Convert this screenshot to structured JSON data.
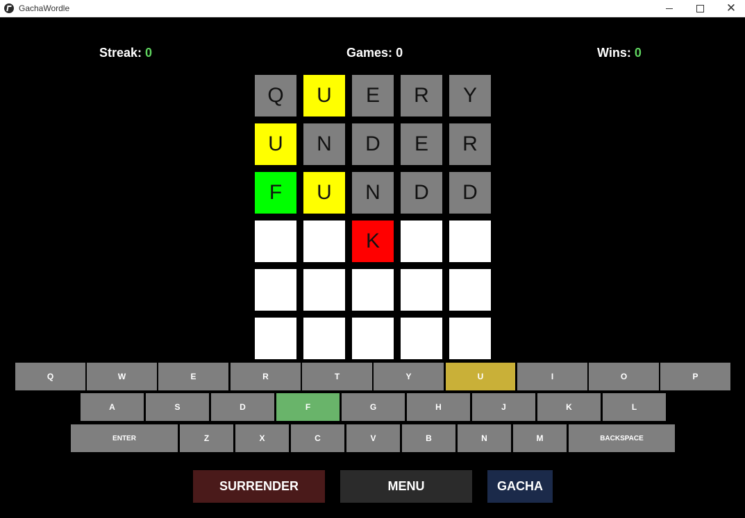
{
  "window": {
    "title": "GachaWordle",
    "minimize_icon": "minimize-icon",
    "maximize_icon": "maximize-icon",
    "close_icon": "close-icon",
    "close_glyph": "✕"
  },
  "stats": {
    "streak_label": "Streak:",
    "streak_value": "0",
    "games_label": "Games:",
    "games_value": "0",
    "wins_label": "Wins:",
    "wins_value": "0"
  },
  "colors": {
    "tile_gray": "#7f7f7f",
    "tile_yellow": "#ffff00",
    "tile_green": "#00ff00",
    "tile_red": "#ff0000",
    "tile_empty": "#ffffff",
    "key_default": "#7f7f7f",
    "key_present": "#c9b038",
    "key_correct": "#69b46a",
    "surrender_bg": "#4a1a1a",
    "menu_bg": "#2b2b2b",
    "gacha_bg": "#1b2a4a",
    "stat_value": "#5fd35f"
  },
  "board": [
    [
      {
        "letter": "Q",
        "state": "gray"
      },
      {
        "letter": "U",
        "state": "yellow"
      },
      {
        "letter": "E",
        "state": "gray"
      },
      {
        "letter": "R",
        "state": "gray"
      },
      {
        "letter": "Y",
        "state": "gray"
      }
    ],
    [
      {
        "letter": "U",
        "state": "yellow"
      },
      {
        "letter": "N",
        "state": "gray"
      },
      {
        "letter": "D",
        "state": "gray"
      },
      {
        "letter": "E",
        "state": "gray"
      },
      {
        "letter": "R",
        "state": "gray"
      }
    ],
    [
      {
        "letter": "F",
        "state": "green"
      },
      {
        "letter": "U",
        "state": "yellow"
      },
      {
        "letter": "N",
        "state": "gray"
      },
      {
        "letter": "D",
        "state": "gray"
      },
      {
        "letter": "D",
        "state": "gray"
      }
    ],
    [
      {
        "letter": "",
        "state": "empty"
      },
      {
        "letter": "",
        "state": "empty"
      },
      {
        "letter": "K",
        "state": "red"
      },
      {
        "letter": "",
        "state": "empty"
      },
      {
        "letter": "",
        "state": "empty"
      }
    ],
    [
      {
        "letter": "",
        "state": "empty"
      },
      {
        "letter": "",
        "state": "empty"
      },
      {
        "letter": "",
        "state": "empty"
      },
      {
        "letter": "",
        "state": "empty"
      },
      {
        "letter": "",
        "state": "empty"
      }
    ],
    [
      {
        "letter": "",
        "state": "empty"
      },
      {
        "letter": "",
        "state": "empty"
      },
      {
        "letter": "",
        "state": "empty"
      },
      {
        "letter": "",
        "state": "empty"
      },
      {
        "letter": "",
        "state": "empty"
      }
    ]
  ],
  "keyboard": {
    "rows": [
      [
        {
          "label": "Q",
          "state": "default"
        },
        {
          "label": "W",
          "state": "default"
        },
        {
          "label": "E",
          "state": "default"
        },
        {
          "label": "R",
          "state": "default"
        },
        {
          "label": "T",
          "state": "default"
        },
        {
          "label": "Y",
          "state": "default"
        },
        {
          "label": "U",
          "state": "present"
        },
        {
          "label": "I",
          "state": "default"
        },
        {
          "label": "O",
          "state": "default"
        },
        {
          "label": "P",
          "state": "default"
        }
      ],
      [
        {
          "label": "A",
          "state": "default"
        },
        {
          "label": "S",
          "state": "default"
        },
        {
          "label": "D",
          "state": "default"
        },
        {
          "label": "F",
          "state": "correct"
        },
        {
          "label": "G",
          "state": "default"
        },
        {
          "label": "H",
          "state": "default"
        },
        {
          "label": "J",
          "state": "default"
        },
        {
          "label": "K",
          "state": "default"
        },
        {
          "label": "L",
          "state": "default"
        }
      ],
      [
        {
          "label": "ENTER",
          "state": "default"
        },
        {
          "label": "Z",
          "state": "default"
        },
        {
          "label": "X",
          "state": "default"
        },
        {
          "label": "C",
          "state": "default"
        },
        {
          "label": "V",
          "state": "default"
        },
        {
          "label": "B",
          "state": "default"
        },
        {
          "label": "N",
          "state": "default"
        },
        {
          "label": "M",
          "state": "default"
        },
        {
          "label": "BACKSPACE",
          "state": "default"
        }
      ]
    ]
  },
  "actions": {
    "surrender_label": "SURRENDER",
    "menu_label": "MENU",
    "gacha_label": "GACHA"
  }
}
